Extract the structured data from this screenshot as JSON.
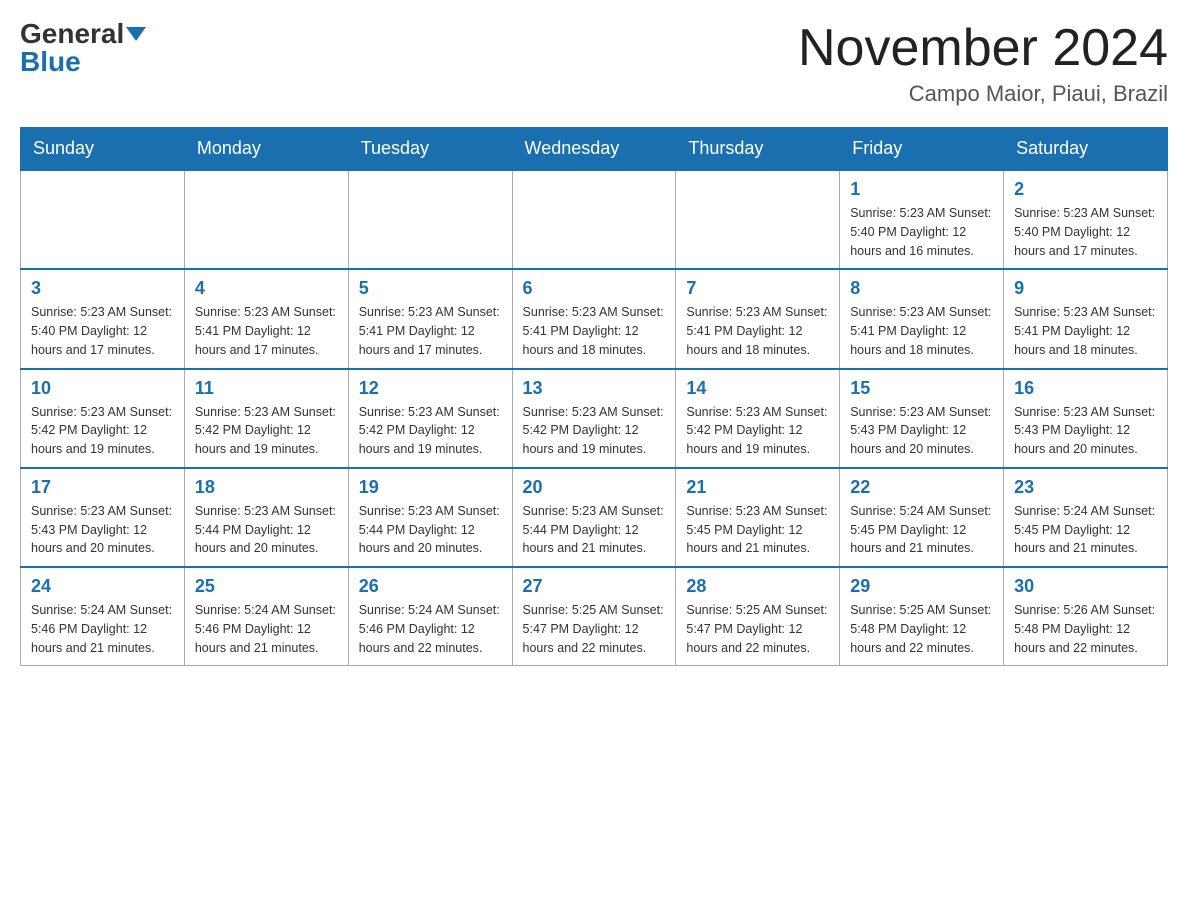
{
  "header": {
    "logo_general": "General",
    "logo_blue": "Blue",
    "month_title": "November 2024",
    "location": "Campo Maior, Piaui, Brazil"
  },
  "days_of_week": [
    "Sunday",
    "Monday",
    "Tuesday",
    "Wednesday",
    "Thursday",
    "Friday",
    "Saturday"
  ],
  "weeks": [
    {
      "days": [
        {
          "num": "",
          "info": ""
        },
        {
          "num": "",
          "info": ""
        },
        {
          "num": "",
          "info": ""
        },
        {
          "num": "",
          "info": ""
        },
        {
          "num": "",
          "info": ""
        },
        {
          "num": "1",
          "info": "Sunrise: 5:23 AM\nSunset: 5:40 PM\nDaylight: 12 hours and 16 minutes."
        },
        {
          "num": "2",
          "info": "Sunrise: 5:23 AM\nSunset: 5:40 PM\nDaylight: 12 hours and 17 minutes."
        }
      ]
    },
    {
      "days": [
        {
          "num": "3",
          "info": "Sunrise: 5:23 AM\nSunset: 5:40 PM\nDaylight: 12 hours and 17 minutes."
        },
        {
          "num": "4",
          "info": "Sunrise: 5:23 AM\nSunset: 5:41 PM\nDaylight: 12 hours and 17 minutes."
        },
        {
          "num": "5",
          "info": "Sunrise: 5:23 AM\nSunset: 5:41 PM\nDaylight: 12 hours and 17 minutes."
        },
        {
          "num": "6",
          "info": "Sunrise: 5:23 AM\nSunset: 5:41 PM\nDaylight: 12 hours and 18 minutes."
        },
        {
          "num": "7",
          "info": "Sunrise: 5:23 AM\nSunset: 5:41 PM\nDaylight: 12 hours and 18 minutes."
        },
        {
          "num": "8",
          "info": "Sunrise: 5:23 AM\nSunset: 5:41 PM\nDaylight: 12 hours and 18 minutes."
        },
        {
          "num": "9",
          "info": "Sunrise: 5:23 AM\nSunset: 5:41 PM\nDaylight: 12 hours and 18 minutes."
        }
      ]
    },
    {
      "days": [
        {
          "num": "10",
          "info": "Sunrise: 5:23 AM\nSunset: 5:42 PM\nDaylight: 12 hours and 19 minutes."
        },
        {
          "num": "11",
          "info": "Sunrise: 5:23 AM\nSunset: 5:42 PM\nDaylight: 12 hours and 19 minutes."
        },
        {
          "num": "12",
          "info": "Sunrise: 5:23 AM\nSunset: 5:42 PM\nDaylight: 12 hours and 19 minutes."
        },
        {
          "num": "13",
          "info": "Sunrise: 5:23 AM\nSunset: 5:42 PM\nDaylight: 12 hours and 19 minutes."
        },
        {
          "num": "14",
          "info": "Sunrise: 5:23 AM\nSunset: 5:42 PM\nDaylight: 12 hours and 19 minutes."
        },
        {
          "num": "15",
          "info": "Sunrise: 5:23 AM\nSunset: 5:43 PM\nDaylight: 12 hours and 20 minutes."
        },
        {
          "num": "16",
          "info": "Sunrise: 5:23 AM\nSunset: 5:43 PM\nDaylight: 12 hours and 20 minutes."
        }
      ]
    },
    {
      "days": [
        {
          "num": "17",
          "info": "Sunrise: 5:23 AM\nSunset: 5:43 PM\nDaylight: 12 hours and 20 minutes."
        },
        {
          "num": "18",
          "info": "Sunrise: 5:23 AM\nSunset: 5:44 PM\nDaylight: 12 hours and 20 minutes."
        },
        {
          "num": "19",
          "info": "Sunrise: 5:23 AM\nSunset: 5:44 PM\nDaylight: 12 hours and 20 minutes."
        },
        {
          "num": "20",
          "info": "Sunrise: 5:23 AM\nSunset: 5:44 PM\nDaylight: 12 hours and 21 minutes."
        },
        {
          "num": "21",
          "info": "Sunrise: 5:23 AM\nSunset: 5:45 PM\nDaylight: 12 hours and 21 minutes."
        },
        {
          "num": "22",
          "info": "Sunrise: 5:24 AM\nSunset: 5:45 PM\nDaylight: 12 hours and 21 minutes."
        },
        {
          "num": "23",
          "info": "Sunrise: 5:24 AM\nSunset: 5:45 PM\nDaylight: 12 hours and 21 minutes."
        }
      ]
    },
    {
      "days": [
        {
          "num": "24",
          "info": "Sunrise: 5:24 AM\nSunset: 5:46 PM\nDaylight: 12 hours and 21 minutes."
        },
        {
          "num": "25",
          "info": "Sunrise: 5:24 AM\nSunset: 5:46 PM\nDaylight: 12 hours and 21 minutes."
        },
        {
          "num": "26",
          "info": "Sunrise: 5:24 AM\nSunset: 5:46 PM\nDaylight: 12 hours and 22 minutes."
        },
        {
          "num": "27",
          "info": "Sunrise: 5:25 AM\nSunset: 5:47 PM\nDaylight: 12 hours and 22 minutes."
        },
        {
          "num": "28",
          "info": "Sunrise: 5:25 AM\nSunset: 5:47 PM\nDaylight: 12 hours and 22 minutes."
        },
        {
          "num": "29",
          "info": "Sunrise: 5:25 AM\nSunset: 5:48 PM\nDaylight: 12 hours and 22 minutes."
        },
        {
          "num": "30",
          "info": "Sunrise: 5:26 AM\nSunset: 5:48 PM\nDaylight: 12 hours and 22 minutes."
        }
      ]
    }
  ]
}
